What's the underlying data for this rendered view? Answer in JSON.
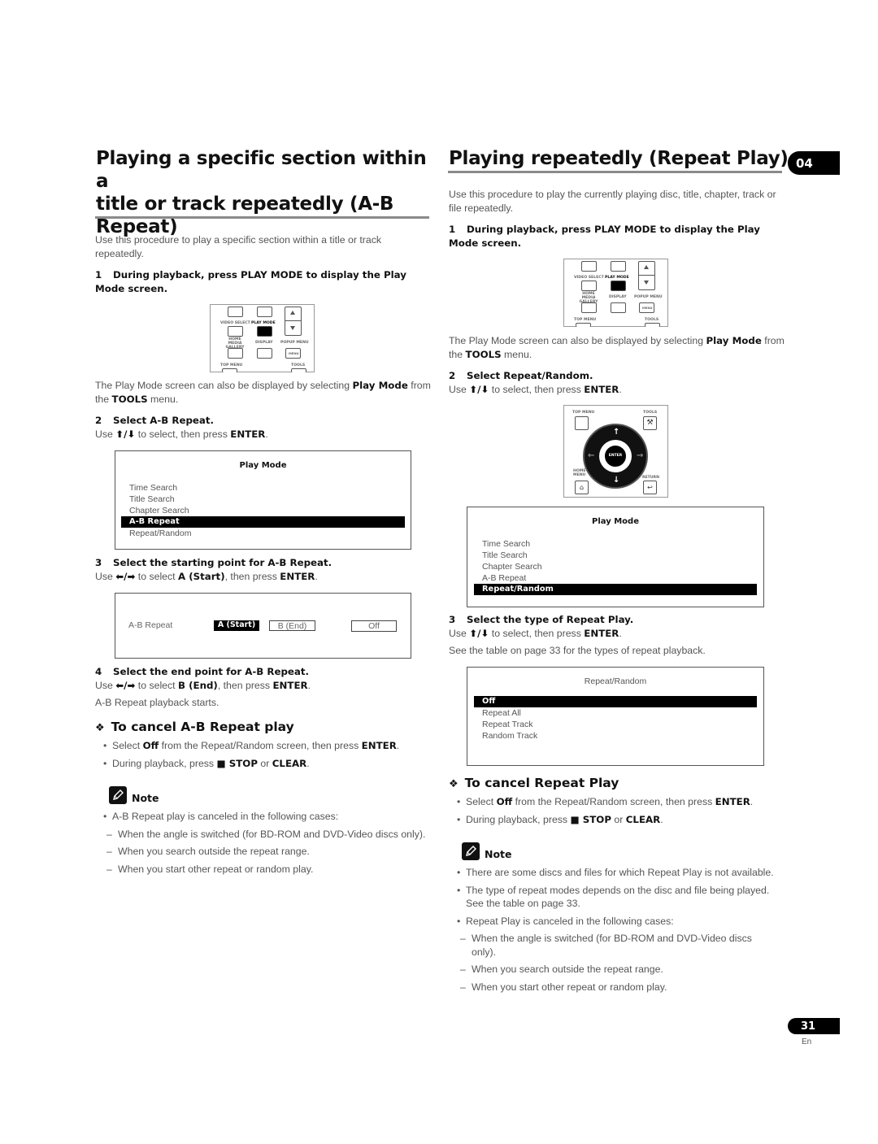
{
  "chapter_tab": "04",
  "page_number": "31",
  "page_lang": "En",
  "left": {
    "title_lines": [
      "Playing a specific section within a",
      "title or track repeatedly (A-B",
      "Repeat)"
    ],
    "intro": "Use this procedure to play a specific section within a title or track repeatedly.",
    "step1": {
      "num": "1",
      "text": "During playback, press PLAY MODE to display the Play Mode screen."
    },
    "remote_labels": {
      "video_select": "VIDEO SELECT",
      "play_mode": "PLAY MODE",
      "home_media_gallery": "HOME MEDIA GALLERY",
      "display": "DISPLAY",
      "popup_menu": "POPUP MENU",
      "menu": "MENU",
      "top_menu": "TOP MENU",
      "tools": "TOOLS"
    },
    "also_text": {
      "pre": "The Play Mode screen can also be displayed by selecting ",
      "b1": "Play Mode",
      "mid": " from the ",
      "b2": "TOOLS",
      "post": " menu."
    },
    "step2": {
      "num": "2",
      "text": "Select A-B Repeat.",
      "use": "Use",
      "arrows": "⬆/⬇",
      "rest": " to select, then press ",
      "enter": "ENTER",
      "dot": "."
    },
    "play_mode_screen": {
      "title": "Play Mode",
      "items": [
        "Time Search",
        "Title Search",
        "Chapter Search",
        "A-B Repeat",
        "Repeat/Random"
      ],
      "selected": "A-B Repeat"
    },
    "step3": {
      "num": "3",
      "text": "Select the starting point for A-B Repeat.",
      "use": "Use",
      "arrows": "⬅/➡",
      "rest": " to select ",
      "target": "A (Start)",
      "rest2": ", then press ",
      "enter": "ENTER",
      "dot": "."
    },
    "ab_screen": {
      "label": "A-B Repeat",
      "a_start": "A (Start)",
      "b_end": "B (End)",
      "off": "Off"
    },
    "step4": {
      "num": "4",
      "text": "Select the end point for A-B Repeat.",
      "use": "Use",
      "arrows": "⬅/➡",
      "rest": " to select ",
      "target": "B (End)",
      "rest2": ", then press ",
      "enter": "ENTER",
      "dot": "."
    },
    "step4_result": "A-B Repeat playback starts.",
    "cancel": {
      "heading": "To cancel A-B Repeat play",
      "bullet1": {
        "pre": "Select ",
        "b1": "Off",
        "mid": " from the Repeat/Random screen, then press ",
        "b2": "ENTER",
        "post": "."
      },
      "bullet2": {
        "pre": "During playback, press ",
        "stop_icon": "■",
        "b1": " STOP",
        "mid": " or ",
        "b2": "CLEAR",
        "post": "."
      }
    },
    "note": {
      "heading": "Note",
      "bullet": "A-B Repeat play is canceled in the following cases:",
      "dashes": [
        "When the angle is switched (for BD-ROM and DVD-Video discs only).",
        "When you search outside the repeat range.",
        "When you start other repeat or random play."
      ]
    }
  },
  "right": {
    "title": "Playing repeatedly (Repeat Play)",
    "intro": "Use this procedure to play the currently playing disc, title, chapter, track or file repeatedly.",
    "step1": {
      "num": "1",
      "text": "During playback, press PLAY MODE to display the Play Mode screen."
    },
    "also_text": {
      "pre": "The Play Mode screen can also be displayed by selecting ",
      "b1": "Play Mode",
      "mid": " from the ",
      "b2": "TOOLS",
      "post": " menu."
    },
    "step2": {
      "num": "2",
      "text": "Select Repeat/Random.",
      "use": "Use",
      "arrows": "⬆/⬇",
      "rest": " to select, then press ",
      "enter": "ENTER",
      "dot": "."
    },
    "nav_labels": {
      "top_menu": "TOP MENU",
      "tools": "TOOLS",
      "enter": "ENTER",
      "home_menu": "HOME MENU",
      "return": "RETURN"
    },
    "play_mode_screen": {
      "title": "Play Mode",
      "items": [
        "Time Search",
        "Title Search",
        "Chapter Search",
        "A-B Repeat",
        "Repeat/Random"
      ],
      "selected": "Repeat/Random"
    },
    "step3": {
      "num": "3",
      "text": "Select the type of Repeat Play.",
      "use": "Use",
      "arrows": "⬆/⬇",
      "rest": " to select, then press ",
      "enter": "ENTER",
      "dot": "."
    },
    "step3_note": "See the table on page 33 for the types of repeat playback.",
    "repeat_screen": {
      "title": "Repeat/Random",
      "items": [
        "Off",
        "Repeat All",
        "Repeat Track",
        "Random Track"
      ],
      "selected": "Off"
    },
    "cancel": {
      "heading": "To cancel Repeat Play",
      "bullet1": {
        "pre": "Select ",
        "b1": "Off",
        "mid": " from the Repeat/Random screen, then press ",
        "b2": "ENTER",
        "post": "."
      },
      "bullet2": {
        "pre": "During playback, press ",
        "stop_icon": "■",
        "b1": " STOP",
        "mid": " or ",
        "b2": "CLEAR",
        "post": "."
      }
    },
    "note": {
      "heading": "Note",
      "bullets": [
        "There are some discs and files for which Repeat Play is not available.",
        "The type of repeat modes depends on the disc and file being played. See the table on page 33.",
        "Repeat Play is canceled in the following cases:"
      ],
      "dashes": [
        "When the angle is switched (for BD-ROM and DVD-Video discs only).",
        "When you search outside the repeat range.",
        "When you start other repeat or random play."
      ]
    }
  }
}
